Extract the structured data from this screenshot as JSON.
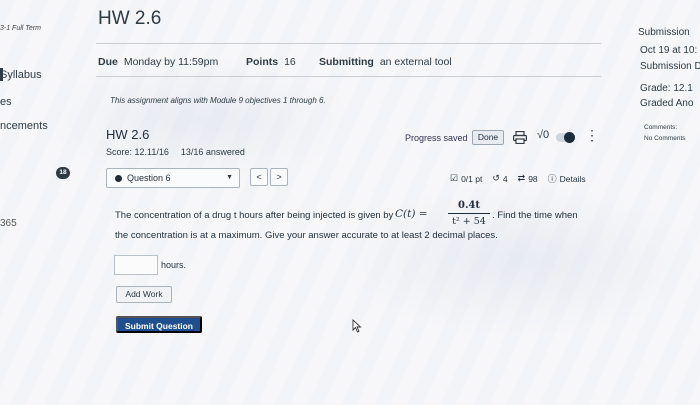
{
  "left_nav": {
    "term": "3-1 Full Term",
    "items": [
      "Syllabus",
      "es",
      "ncements"
    ],
    "number": "365"
  },
  "header": {
    "title": "HW 2.6",
    "due_label": "Due",
    "due_value": "Monday by 11:59pm",
    "points_label": "Points",
    "points_value": "16",
    "submitting_label": "Submitting",
    "submitting_value": "an external tool",
    "alignment_note": "This assignment aligns with Module 9 objectives 1 through 6."
  },
  "right_sidebar": {
    "heading": "Submission",
    "date": "Oct 19 at 10:",
    "submission_detail": "Submission D",
    "grade": "Grade: 12.1",
    "graded_status": "Graded Ano",
    "comments_label": "Comments:",
    "comments_value": "No Comments"
  },
  "tool": {
    "title": "HW 2.6",
    "score": "Score: 12.11/16",
    "answered": "13/16 answered",
    "progress_saved": "Progress saved",
    "done_label": "Done",
    "sqrt_icon": "√0",
    "badge": "18",
    "question_label": "Question 6",
    "prev_label": "<",
    "next_label": ">",
    "points_status": "0/1 pt",
    "attempts": "4",
    "retries": "98",
    "details_label": "Details"
  },
  "question": {
    "line1_start": "The concentration of a drug t hours after being injected is given by",
    "function": "C(t) =",
    "numerator": "0.4t",
    "denominator": "t² + 54",
    "line1_end": ". Find the time when",
    "line2": "the concentration is at a maximum. Give your answer accurate to at least 2 decimal places.",
    "answer_value": "",
    "answer_unit": "hours.",
    "add_work_label": "Add Work",
    "submit_label": "Submit Question"
  },
  "colors": {
    "accent": "#1f4f8e",
    "text": "#2d3b45",
    "badge": "#2d3b45"
  }
}
